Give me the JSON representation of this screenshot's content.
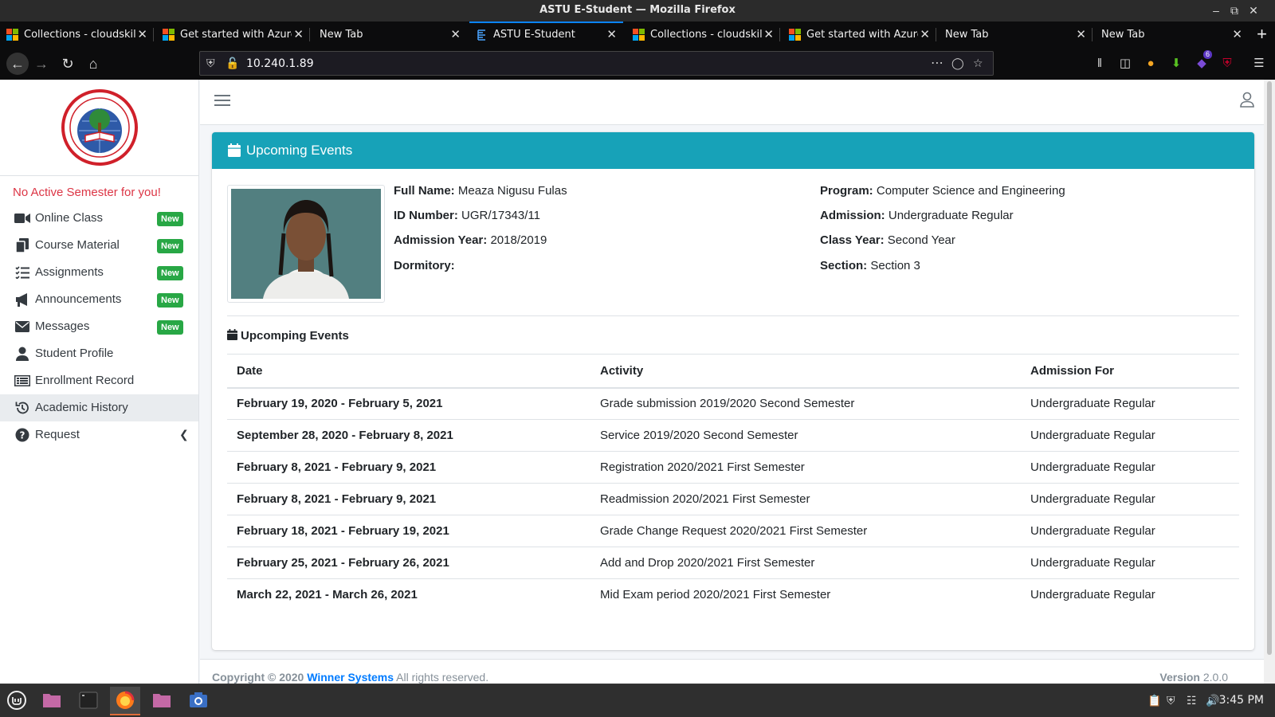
{
  "window": {
    "title": "ASTU E-Student — Mozilla Firefox"
  },
  "tabs": [
    {
      "label": "Collections - cloudskill",
      "icon": "microsoft-icon"
    },
    {
      "label": "Get started with Azure",
      "icon": "microsoft-icon"
    },
    {
      "label": "New Tab",
      "icon": ""
    },
    {
      "label": "ASTU E-Student",
      "icon": "astu-icon",
      "active": true
    },
    {
      "label": "Collections - cloudskill",
      "icon": "microsoft-icon"
    },
    {
      "label": "Get started with Azure",
      "icon": "microsoft-icon"
    },
    {
      "label": "New Tab",
      "icon": ""
    },
    {
      "label": "New Tab",
      "icon": ""
    }
  ],
  "navbar": {
    "url": "10.240.1.89",
    "extension_badge": "6"
  },
  "sidebar": {
    "notice": "No Active Semester for you!",
    "items": [
      {
        "label": "Online Class",
        "badge": "New",
        "icon": "video-icon"
      },
      {
        "label": "Course Material",
        "badge": "New",
        "icon": "copy-icon"
      },
      {
        "label": "Assignments",
        "badge": "New",
        "icon": "tasks-icon"
      },
      {
        "label": "Announcements",
        "badge": "New",
        "icon": "bullhorn-icon"
      },
      {
        "label": "Messages",
        "badge": "New",
        "icon": "envelope-icon"
      },
      {
        "label": "Student Profile",
        "icon": "user-icon"
      },
      {
        "label": "Enrollment Record",
        "icon": "list-icon"
      },
      {
        "label": "Academic History",
        "icon": "history-icon",
        "active": true
      },
      {
        "label": "Request",
        "icon": "question-icon"
      }
    ]
  },
  "card": {
    "title": "Upcoming Events",
    "profile": {
      "full_name_label": "Full Name:",
      "full_name": "Meaza Nigusu Fulas",
      "id_label": "ID Number:",
      "id": "UGR/17343/11",
      "adm_year_label": "Admission Year:",
      "adm_year": "2018/2019",
      "dorm_label": "Dormitory:",
      "dorm": "",
      "program_label": "Program:",
      "program": "Computer Science and Engineering",
      "admission_label": "Admission:",
      "admission": "Undergraduate Regular",
      "class_year_label": "Class Year:",
      "class_year": "Second Year",
      "section_label": "Section:",
      "section": "Section 3"
    },
    "events_title": "Upcomping Events",
    "columns": [
      "Date",
      "Activity",
      "Admission For"
    ],
    "rows": [
      {
        "date": "February 19, 2020 - February 5, 2021",
        "activity": "Grade submission 2019/2020 Second Semester",
        "for": "Undergraduate Regular"
      },
      {
        "date": "September 28, 2020 - February 8, 2021",
        "activity": "Service 2019/2020 Second Semester",
        "for": "Undergraduate Regular"
      },
      {
        "date": "February 8, 2021 - February 9, 2021",
        "activity": "Registration 2020/2021 First Semester",
        "for": "Undergraduate Regular"
      },
      {
        "date": "February 8, 2021 - February 9, 2021",
        "activity": "Readmission 2020/2021 First Semester",
        "for": "Undergraduate Regular"
      },
      {
        "date": "February 18, 2021 - February 19, 2021",
        "activity": "Grade Change Request 2020/2021 First Semester",
        "for": "Undergraduate Regular"
      },
      {
        "date": "February 25, 2021 - February 26, 2021",
        "activity": "Add and Drop 2020/2021 First Semester",
        "for": "Undergraduate Regular"
      },
      {
        "date": "March 22, 2021 - March 26, 2021",
        "activity": "Mid Exam period 2020/2021 First Semester",
        "for": "Undergraduate Regular"
      }
    ]
  },
  "footer": {
    "copyright_prefix": "Copyright © 2020",
    "company": "Winner Systems",
    "rights": "All rights reserved.",
    "version_label": "Version",
    "version": "2.0.0"
  },
  "taskbar": {
    "clock": "3:45 PM"
  },
  "colors": {
    "accent": "#17a2b8",
    "badge": "#28a745",
    "notice": "#dc3545",
    "tab_highlight": "#0a84ff"
  }
}
